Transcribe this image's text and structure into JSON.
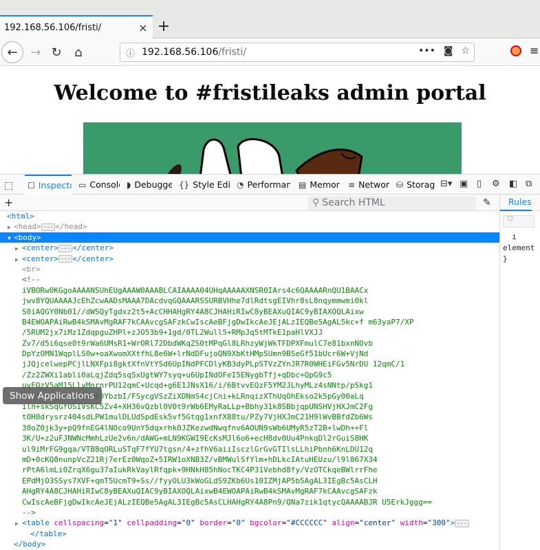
{
  "browser": {
    "tab_title": "192.168.56.106/fristi/",
    "tab_close": "×",
    "new_tab": "+",
    "url_host": "192.168.56.106",
    "url_path": "/fristi/",
    "page_actions": "•••"
  },
  "page": {
    "heading": "Welcome to #fristileaks admin portal",
    "logo_color": "#3a9a6a"
  },
  "devtools": {
    "tabs": [
      {
        "label": "Inspector",
        "icon": "inspector-icon"
      },
      {
        "label": "Console",
        "icon": "console-icon"
      },
      {
        "label": "Debugger",
        "icon": "debugger-icon"
      },
      {
        "label": "Style Editor",
        "icon": "style-editor-icon"
      },
      {
        "label": "Performance",
        "icon": "performance-icon"
      },
      {
        "label": "Memory",
        "icon": "memory-icon"
      },
      {
        "label": "Network",
        "icon": "network-icon"
      },
      {
        "label": "Storage",
        "icon": "storage-icon"
      }
    ],
    "search_placeholder": "Search HTML",
    "rules_tab": "Rules",
    "rules_text": "  i\nelement\n}"
  },
  "markup": {
    "html_open": "<html>",
    "head": "<head>",
    "head_close": "</head>",
    "body_open": "<body>",
    "center_open": "<center>",
    "center_close": "</center>",
    "br": "<br>",
    "comment_open": "<!--",
    "comment_close": "-->",
    "comment_lines": [
      "iVBORw0KGgoAAAANSUhEUgAAAW0AAABLCAIAAAA04UHqAAAAAXNSR0IArs4c6QAAAARnQU1BAACx",
      "jwv8YQUAAAAJcEhZcwAADsMAAA7DAcdvqGQAAARSSURBVHhe7dlRdtsgEIVhr8sL8nqymmwmi0kl",
      "S0iAQGY0Nb01//dWSQyTgdxz2t5+AcCHHAHgRY4A8CJHAHiRIwC8yBEAXuQIAC9yBIAXOQLAixw",
      "B4EWOAPAiRwB4kSMAvMgRAF7kCAAvcgSAFzkCwIscAeBFjgDwIkcAeJEjALzIEQBe5AgAL5kc+f m63yaP7/XP",
      "/5RUM2jx7iMz1ZdqpguZHPl+zJO53b9+1gd/0TL2Wull5+RMpJq5tMTkE1paHlVXJJ",
      "Zv7/d5i6qse0t9rWa6UMsR1+WrORl72DbdWKqZS0tMPqGl8LRhzyWjWkTFDPXFmulC7e81bxnNOvb",
      "DpYzOMN1WqplLS0w+oaXwomXXtfhL8e6W+lrNdDFujoQN9XbKtHMpSUmn9BSeGf51bUcr6W+VjNd",
      "jJQjcelwepPCjlLNXFpi8gktXfnVtYSd6UpINdPFCDlyKB3dyPLpSTVzZYnJR7R0WHEiFGv5NrDU 12qmC/1",
      "/Zz2ZWXi1abli0aLqjZdq5sqSxUgtWY7syq+u6UpINdOFeI5ENygbTfj+qDbc+QpG9c5",
      "uvFQzV5aM15LlyMnrnrPU12qmC+Ucqd+g6E1JNsX16/i/6BtvvEQzF5YM2JLhyMLz4sNNtp/pSkg1",
      "P+2IOpsgJBBCuJr9E0YbzbI/FSycgVSzZiXDNmS4cjCni+kLRnqizXThUqOhEkso2k5pGy00aLq",
      "iln+skSqGfOSIVsKC5Zv4+XH36vQzbl0V0t9rWb6EMyRaLLp+Bbhy31k8SBbjqpUNSHVjHXJmC2Fg",
      "tOH0drysrz404sdLPW1mulDLUdSpdEsk5vf5Gtqg1xnfX88tu/PZy7VjHXJmC21H9lWvBBfdZb6Ws",
      "30oZ0jk3y+pQ9fnEG4lNOco9UnY5dqxrhk0JZKezwdNwqfnv6AOUN9sWb6UMyR5zT2B+lwDh++Fl",
      "3K/U+z2uFJNWNcMmhLzUe2v6n/dAWG+mLN9KGWI9EcKsMJl6o6+ecH8dv0Uu4PnkqDl2rGuiS8HK",
      "ul9iMrFG9gqa/VTB8qORLuSTqF7fYU7tgsn/4+zfhV6aiiIsczlGrGvGTIlsLLhiPbnh6KnLDU12q",
      "mD+0cKQ8nunpVcZ21Rj7erEz0WqoZ+5IRW1oXNB3Z/vBMWulSfYlm+hDLkcIAtuHEUzu/l9l867X34",
      "rPtA6lmLi0ZrqX6gu37aIukRkVaylRfqpk+9HNkH85hNocTKC4P31Vebhd8fy/VzOTCkqeBWlrrFhe",
      "EPdMjO3SSys7XVF+qmT5UcmT9+Ss//fyyOLU3kWoGLdS9ZKb6Us10IZMjAP5b5AgAL3IEgBc5AsCLH",
      "AHgRY4A8CJHAHiRIwC8yBEAXuQIAC9yBIAXOQLAixwB4EWOAPAiRwB4kSMAvMgRAF7kCAAvcgSAFzk",
      "CwIscAeBFjgDwIkcAeJEjALzIEQBe5AgAL3IEgBc5AsCLHAHgRY4A8Pn9/QNa7zik1qtycQAAAABJR U5ErkJggg=="
    ],
    "table_line": "<table cellspacing=\"1\" cellpadding=\"0\" border=\"0\" bgcolor=\"#CCCCCC\" align=\"center\" width=\"300\">",
    "table_close": "</table>",
    "body_close": "</body>"
  },
  "overlay": {
    "show_apps": "Show Applications"
  }
}
